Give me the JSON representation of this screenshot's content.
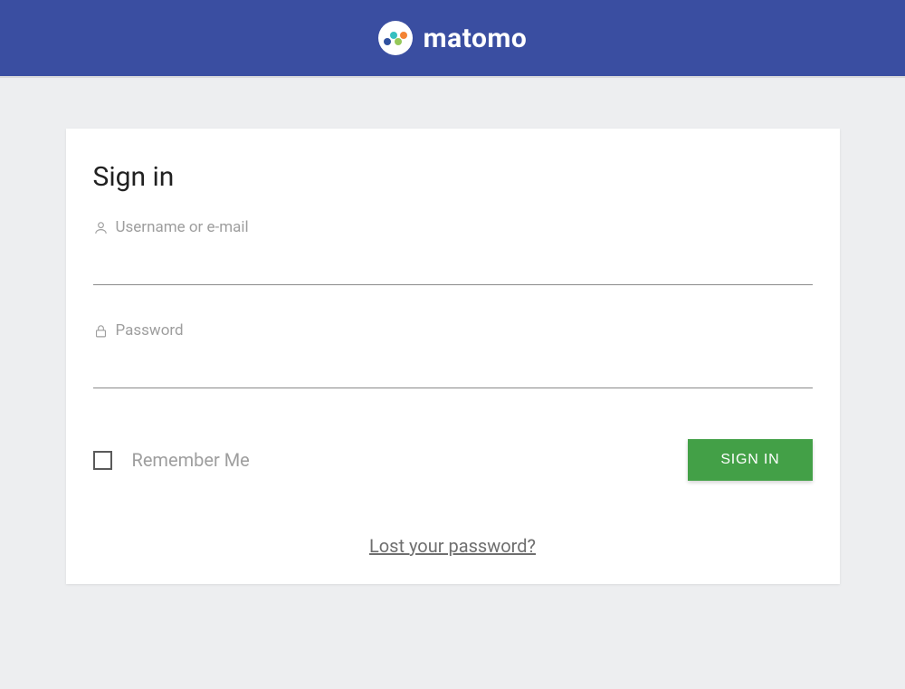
{
  "header": {
    "brand": "matomo"
  },
  "login": {
    "title": "Sign in",
    "username_label": "Username or e-mail",
    "username_value": "",
    "password_label": "Password",
    "password_value": "",
    "remember_label": "Remember Me",
    "submit_label": "SIGN IN",
    "lost_password": "Lost your password?"
  }
}
